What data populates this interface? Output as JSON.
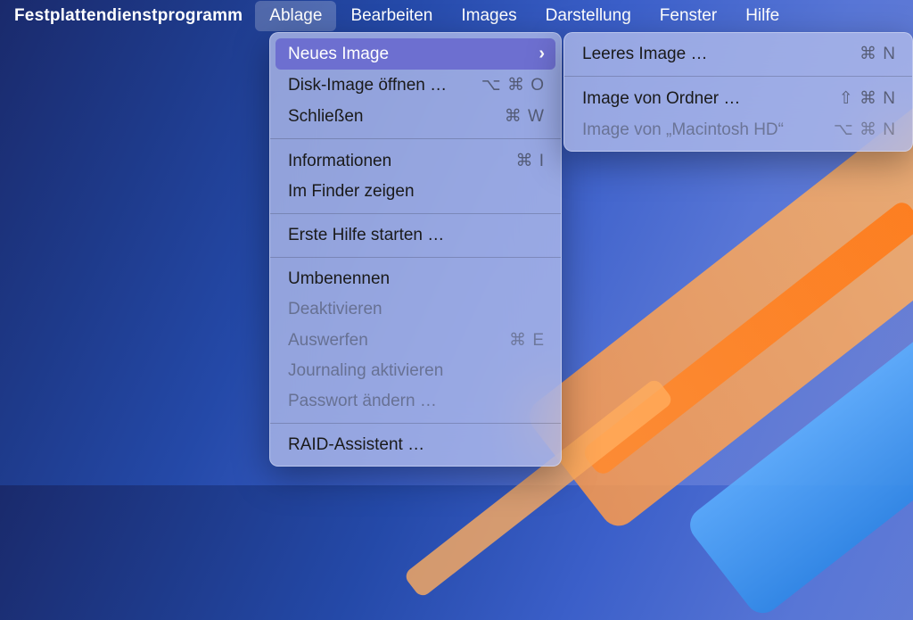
{
  "menubar": {
    "app_name": "Festplattendienstprogramm",
    "items": [
      {
        "label": "Ablage",
        "selected": true
      },
      {
        "label": "Bearbeiten",
        "selected": false
      },
      {
        "label": "Images",
        "selected": false
      },
      {
        "label": "Darstellung",
        "selected": false
      },
      {
        "label": "Fenster",
        "selected": false
      },
      {
        "label": "Hilfe",
        "selected": false
      }
    ]
  },
  "dropdown": {
    "items": [
      {
        "label": "Neues Image",
        "submenu": true,
        "highlight": true
      },
      {
        "label": "Disk-Image öffnen …",
        "shortcut": "⌥ ⌘ O"
      },
      {
        "label": "Schließen",
        "shortcut": "⌘ W"
      },
      {
        "sep": true
      },
      {
        "label": "Informationen",
        "shortcut": "⌘ I"
      },
      {
        "label": "Im Finder zeigen"
      },
      {
        "sep": true
      },
      {
        "label": "Erste Hilfe starten …"
      },
      {
        "sep": true
      },
      {
        "label": "Umbenennen"
      },
      {
        "label": "Deaktivieren",
        "disabled": true
      },
      {
        "label": "Auswerfen",
        "shortcut": "⌘ E",
        "disabled": true
      },
      {
        "label": "Journaling aktivieren",
        "disabled": true
      },
      {
        "label": "Passwort ändern …",
        "disabled": true
      },
      {
        "sep": true
      },
      {
        "label": "RAID-Assistent …"
      }
    ]
  },
  "submenu": {
    "items": [
      {
        "label": "Leeres Image …",
        "shortcut": "⌘ N"
      },
      {
        "sep": true
      },
      {
        "label": "Image von Ordner …",
        "shortcut": "⇧ ⌘ N"
      },
      {
        "label": "Image von „Macintosh HD“",
        "shortcut": "⌥ ⌘ N",
        "disabled": true
      }
    ]
  }
}
